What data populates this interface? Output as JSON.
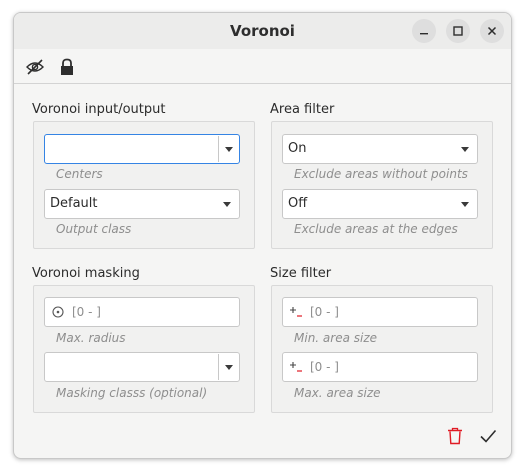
{
  "window": {
    "title": "Voronoi"
  },
  "titlebar_buttons": {
    "minimize_icon": "minimize-icon",
    "maximize_icon": "maximize-icon",
    "close_icon": "close-icon"
  },
  "toolbar": {
    "visibility_icon": "eye-slash-icon",
    "lock_icon": "lock-icon"
  },
  "voronoi_io": {
    "title": "Voronoi input/output",
    "centers": {
      "value": "",
      "hint": "Centers"
    },
    "output_class": {
      "value": "Default",
      "hint": "Output class"
    }
  },
  "area_filter": {
    "title": "Area filter",
    "without_points": {
      "value": "On",
      "hint": "Exclude areas without points"
    },
    "at_edges": {
      "value": "Off",
      "hint": "Exclude areas at the edges"
    }
  },
  "voronoi_masking": {
    "title": "Voronoi masking",
    "max_radius": {
      "value": "[0 - ]",
      "hint": "Max. radius",
      "icon": "radius-icon"
    },
    "masking_class": {
      "value": "",
      "hint": "Masking classs (optional)"
    }
  },
  "size_filter": {
    "title": "Size filter",
    "min_area": {
      "value": "[0 - ]",
      "hint": "Min. area size",
      "icon": "plus-minus-icon"
    },
    "max_area": {
      "value": "[0 - ]",
      "hint": "Max. area size",
      "icon": "plus-minus-icon"
    }
  },
  "footer": {
    "delete_icon": "trash-icon",
    "apply_icon": "checkmark-icon",
    "accent": "#e01b24"
  }
}
